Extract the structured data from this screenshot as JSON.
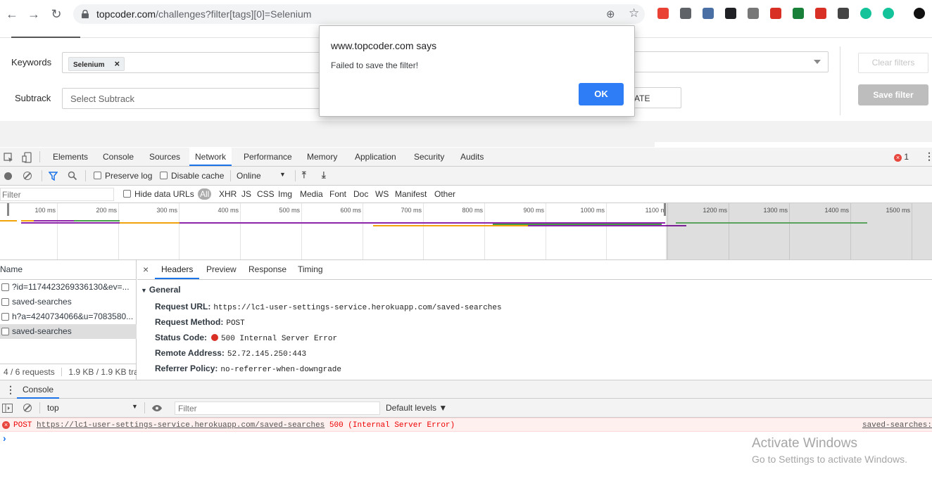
{
  "browser": {
    "url_host": "topcoder.com",
    "url_path": "/challenges?filter[tags][0]=Selenium",
    "extensions": [
      {
        "name": "ext-1",
        "color": "#e94235"
      },
      {
        "name": "ext-2",
        "color": "#5f6368"
      },
      {
        "name": "ext-3",
        "color": "#4a6fa5"
      },
      {
        "name": "ext-4",
        "color": "#202124"
      },
      {
        "name": "ext-5",
        "color": "#777777"
      },
      {
        "name": "ext-6",
        "color": "#d93025"
      },
      {
        "name": "ext-7",
        "color": "#188038"
      },
      {
        "name": "ext-8",
        "color": "#d93025"
      },
      {
        "name": "ext-9",
        "color": "#444444"
      },
      {
        "name": "ext-10",
        "color": "#15c39a"
      },
      {
        "name": "ext-11",
        "color": "#15c39a"
      },
      {
        "name": "ext-12",
        "color": "#111111"
      }
    ]
  },
  "page": {
    "keywords_label": "Keywords",
    "keyword_chip": "Selenium",
    "chip_remove": "×",
    "subtrack_label": "Subtrack",
    "subtrack_placeholder": "Select Subtrack",
    "date_button_partial": "ATE",
    "clear_filters": "Clear filters",
    "save_filter": "Save filter"
  },
  "dialog": {
    "title": "www.topcoder.com says",
    "message": "Failed to save the filter!",
    "ok": "OK"
  },
  "devtools": {
    "tabs": [
      "Elements",
      "Console",
      "Sources",
      "Network",
      "Performance",
      "Memory",
      "Application",
      "Security",
      "Audits"
    ],
    "active_tab": "Network",
    "error_count": "1",
    "preserve_log": "Preserve log",
    "disable_cache": "Disable cache",
    "throttle": "Online",
    "filter_placeholder": "Filter",
    "hide_data_urls": "Hide data URLs",
    "types": [
      "All",
      "XHR",
      "JS",
      "CSS",
      "Img",
      "Media",
      "Font",
      "Doc",
      "WS",
      "Manifest",
      "Other"
    ],
    "ticks": [
      "100 ms",
      "200 ms",
      "300 ms",
      "400 ms",
      "500 ms",
      "600 ms",
      "700 ms",
      "800 ms",
      "900 ms",
      "1000 ms",
      "1100 m",
      "1200 ms",
      "1300 ms",
      "1400 ms",
      "1500 ms"
    ],
    "name_header": "Name",
    "requests": [
      "?id=1174423269336130&ev=...",
      "saved-searches",
      "h?a=4240734066&u=7083580...",
      "saved-searches"
    ],
    "selected_request": 3,
    "summary_requests": "4 / 6 requests",
    "summary_size": "1.9 KB / 1.9 KB tra",
    "detail_tabs": [
      "Headers",
      "Preview",
      "Response",
      "Timing"
    ],
    "detail_close": "×",
    "general_title": "General",
    "general": [
      {
        "k": "Request URL:",
        "v": "https://lc1-user-settings-service.herokuapp.com/saved-searches"
      },
      {
        "k": "Request Method:",
        "v": "POST"
      },
      {
        "k": "Status Code:",
        "v": "500 Internal Server Error"
      },
      {
        "k": "Remote Address:",
        "v": "52.72.145.250:443"
      },
      {
        "k": "Referrer Policy:",
        "v": "no-referrer-when-downgrade"
      }
    ],
    "status_color": "#d93025"
  },
  "console": {
    "drawer_tab": "Console",
    "context": "top",
    "filter_placeholder": "Filter",
    "levels": "Default levels ▼",
    "error_method": "POST",
    "error_url": "https://lc1-user-settings-service.herokuapp.com/saved-searches",
    "error_status": "500 (Internal Server Error)",
    "error_source": "saved-searches:",
    "prompt": "›"
  },
  "watermark": {
    "line1": "Activate Windows",
    "line2": "Go to Settings to activate Windows."
  }
}
